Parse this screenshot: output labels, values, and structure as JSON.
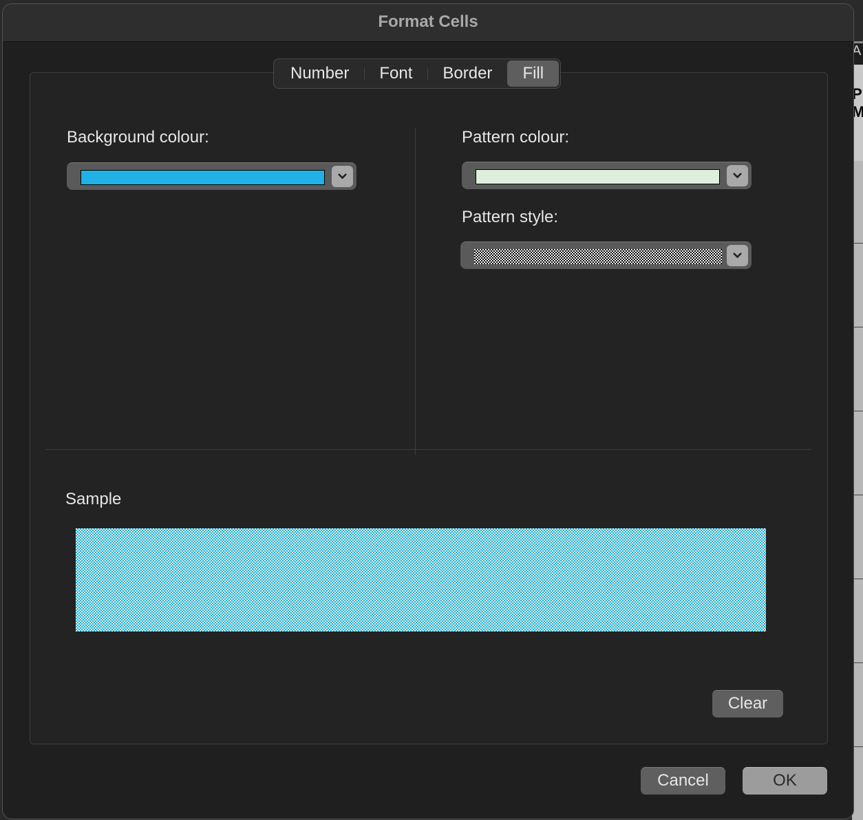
{
  "dialog": {
    "title": "Format Cells"
  },
  "tabs": [
    {
      "label": "Number"
    },
    {
      "label": "Font"
    },
    {
      "label": "Border"
    },
    {
      "label": "Fill",
      "selected": true
    }
  ],
  "fill": {
    "background_label": "Background colour:",
    "background_color": "#20b1e6",
    "pattern_colour_label": "Pattern colour:",
    "pattern_color": "#dfeedd",
    "pattern_style_label": "Pattern style:",
    "pattern_style": "50% grey checkerboard",
    "sample_label": "Sample",
    "clear_label": "Clear"
  },
  "footer": {
    "cancel_label": "Cancel",
    "ok_label": "OK"
  },
  "background_sheet": {
    "col_header": "A",
    "cell_text": [
      "P",
      "M"
    ]
  }
}
